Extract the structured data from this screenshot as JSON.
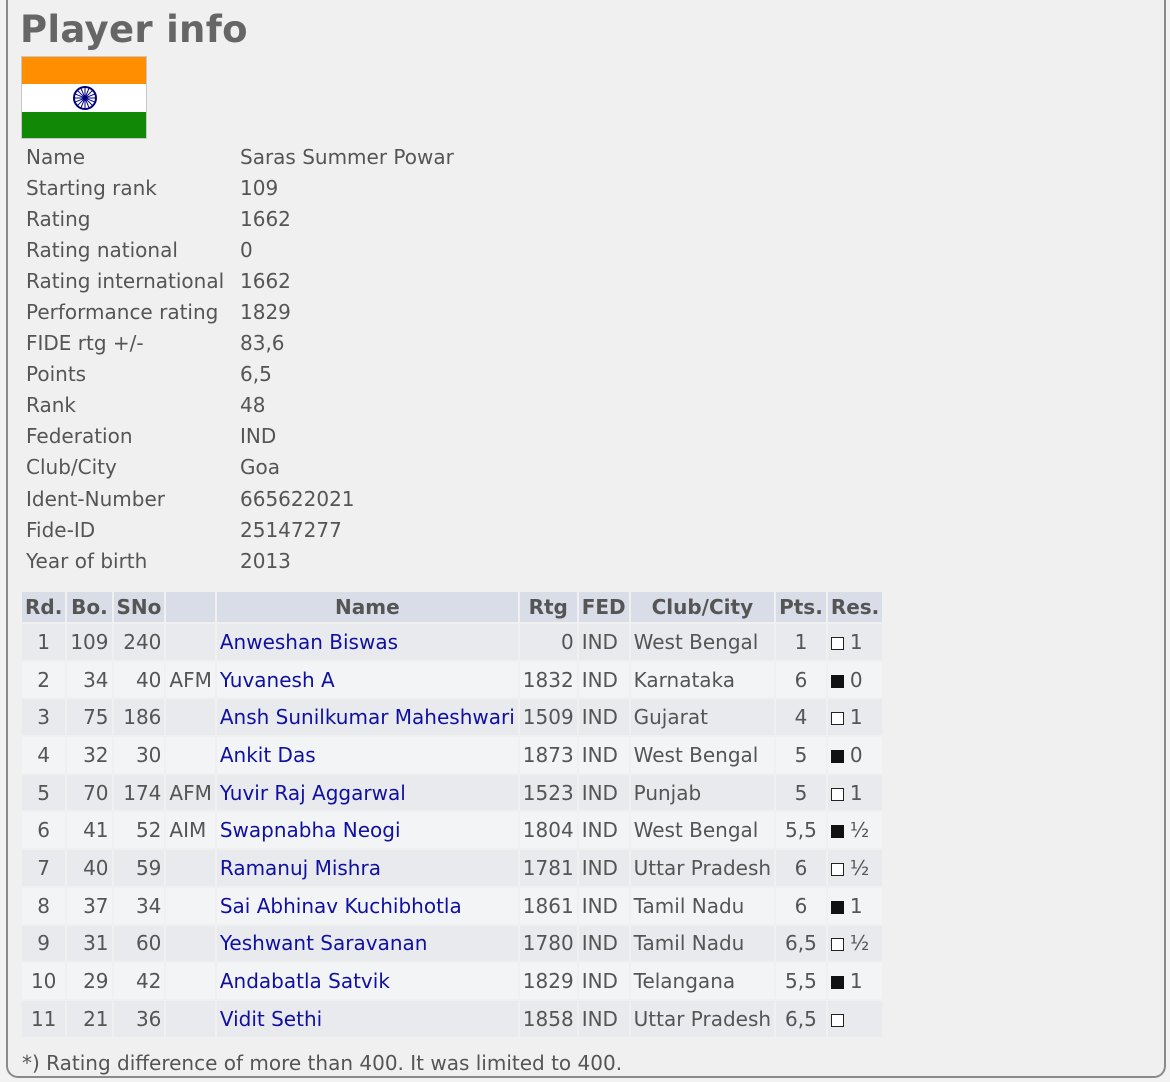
{
  "title": "Player info",
  "flag_icon": "india-flag-icon",
  "info": [
    {
      "label": "Name",
      "value": "Saras Summer Powar"
    },
    {
      "label": "Starting rank",
      "value": "109"
    },
    {
      "label": "Rating",
      "value": "1662"
    },
    {
      "label": "Rating national",
      "value": "0"
    },
    {
      "label": "Rating international",
      "value": "1662"
    },
    {
      "label": "Performance rating",
      "value": "1829"
    },
    {
      "label": "FIDE rtg +/-",
      "value": "83,6"
    },
    {
      "label": "Points",
      "value": "6,5"
    },
    {
      "label": "Rank",
      "value": "48"
    },
    {
      "label": "Federation",
      "value": "IND"
    },
    {
      "label": "Club/City",
      "value": "Goa"
    },
    {
      "label": "Ident-Number",
      "value": "665622021"
    },
    {
      "label": "Fide-ID",
      "value": "25147277"
    },
    {
      "label": "Year of birth",
      "value": "2013"
    }
  ],
  "games": {
    "headers": [
      "Rd.",
      "Bo.",
      "SNo",
      "",
      "Name",
      "Rtg",
      "FED",
      "Club/City",
      "Pts.",
      "Res."
    ],
    "rows": [
      {
        "rd": "1",
        "bo": "109",
        "sno": "240",
        "title": "",
        "name": "Anweshan Biswas",
        "rtg": "0",
        "fed": "IND",
        "club": "West Bengal",
        "pts": "1",
        "color": "white",
        "res": "1"
      },
      {
        "rd": "2",
        "bo": "34",
        "sno": "40",
        "title": "AFM",
        "name": "Yuvanesh A",
        "rtg": "1832",
        "fed": "IND",
        "club": "Karnataka",
        "pts": "6",
        "color": "black",
        "res": "0"
      },
      {
        "rd": "3",
        "bo": "75",
        "sno": "186",
        "title": "",
        "name": "Ansh Sunilkumar Maheshwari",
        "rtg": "1509",
        "fed": "IND",
        "club": "Gujarat",
        "pts": "4",
        "color": "white",
        "res": "1"
      },
      {
        "rd": "4",
        "bo": "32",
        "sno": "30",
        "title": "",
        "name": "Ankit Das",
        "rtg": "1873",
        "fed": "IND",
        "club": "West Bengal",
        "pts": "5",
        "color": "black",
        "res": "0"
      },
      {
        "rd": "5",
        "bo": "70",
        "sno": "174",
        "title": "AFM",
        "name": "Yuvir Raj Aggarwal",
        "rtg": "1523",
        "fed": "IND",
        "club": "Punjab",
        "pts": "5",
        "color": "white",
        "res": "1"
      },
      {
        "rd": "6",
        "bo": "41",
        "sno": "52",
        "title": "AIM",
        "name": "Swapnabha Neogi",
        "rtg": "1804",
        "fed": "IND",
        "club": "West Bengal",
        "pts": "5,5",
        "color": "black",
        "res": "½"
      },
      {
        "rd": "7",
        "bo": "40",
        "sno": "59",
        "title": "",
        "name": "Ramanuj Mishra",
        "rtg": "1781",
        "fed": "IND",
        "club": "Uttar Pradesh",
        "pts": "6",
        "color": "white",
        "res": "½"
      },
      {
        "rd": "8",
        "bo": "37",
        "sno": "34",
        "title": "",
        "name": "Sai Abhinav Kuchibhotla",
        "rtg": "1861",
        "fed": "IND",
        "club": "Tamil Nadu",
        "pts": "6",
        "color": "black",
        "res": "1"
      },
      {
        "rd": "9",
        "bo": "31",
        "sno": "60",
        "title": "",
        "name": "Yeshwant Saravanan",
        "rtg": "1780",
        "fed": "IND",
        "club": "Tamil Nadu",
        "pts": "6,5",
        "color": "white",
        "res": "½"
      },
      {
        "rd": "10",
        "bo": "29",
        "sno": "42",
        "title": "",
        "name": "Andabatla Satvik",
        "rtg": "1829",
        "fed": "IND",
        "club": "Telangana",
        "pts": "5,5",
        "color": "black",
        "res": "1"
      },
      {
        "rd": "11",
        "bo": "21",
        "sno": "36",
        "title": "",
        "name": "Vidit Sethi",
        "rtg": "1858",
        "fed": "IND",
        "club": "Uttar Pradesh",
        "pts": "6,5",
        "color": "white",
        "res": ""
      }
    ]
  },
  "footnote": "*) Rating difference of more than 400. It was limited to 400."
}
